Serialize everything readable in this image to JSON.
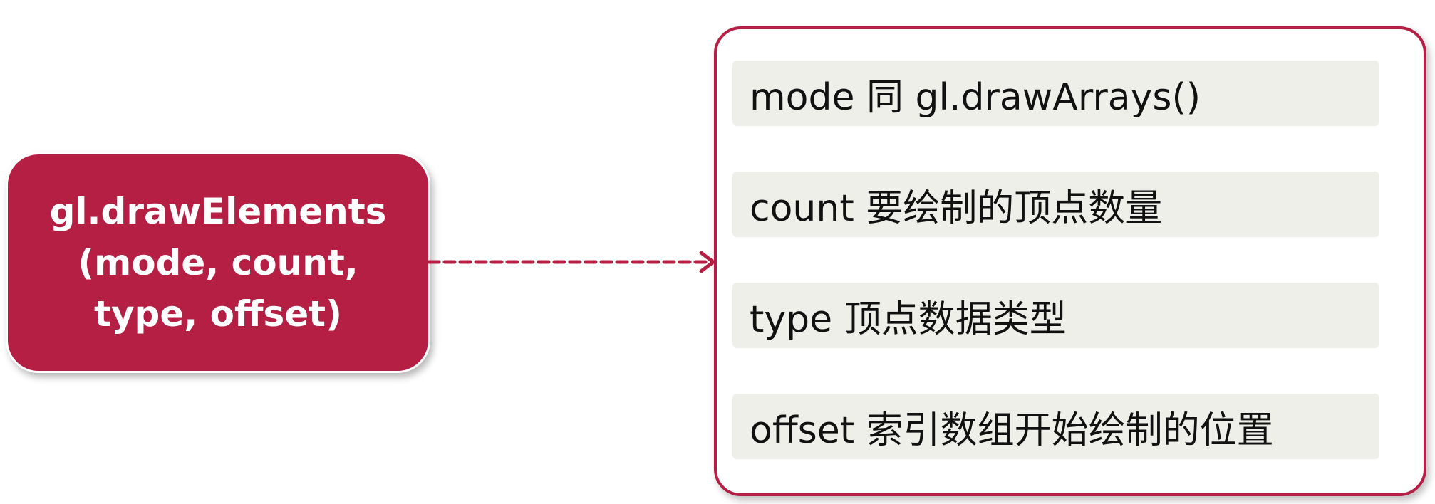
{
  "function_box": {
    "lines": [
      "gl.drawElements",
      "(mode, count,",
      "type, offset)"
    ]
  },
  "parameters": [
    "mode 同 gl.drawArrays()",
    "count 要绘制的顶点数量",
    "type 顶点数据类型",
    "offset 索引数组开始绘制的位置"
  ],
  "colors": {
    "accent": "#b51f44",
    "item_background": "#efefe9",
    "connector": "#b51f44"
  }
}
